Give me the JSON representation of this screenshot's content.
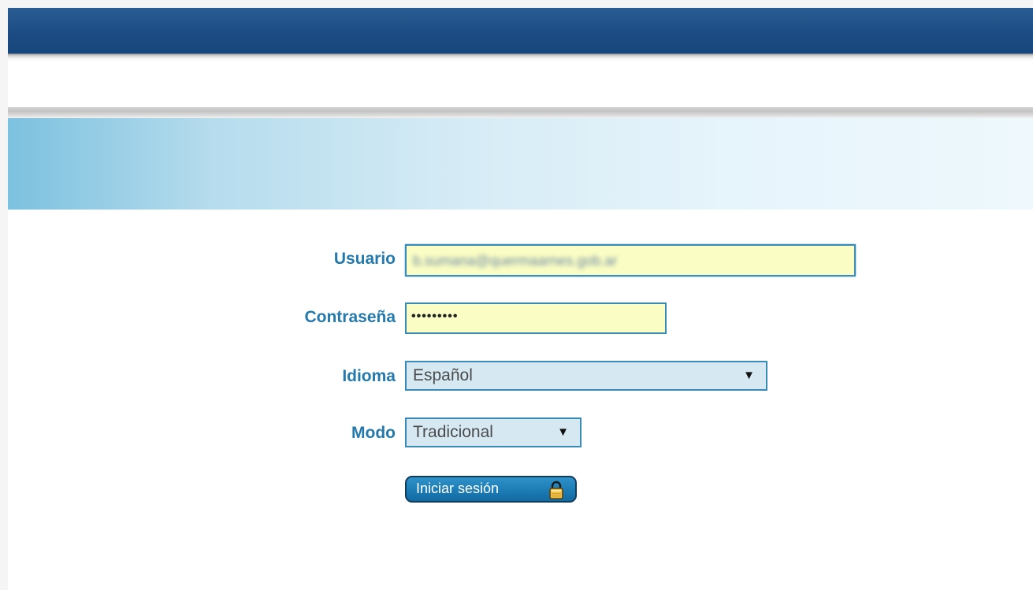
{
  "form": {
    "user": {
      "label": "Usuario",
      "value": "b.sumana@quermaarnes.gob.ar"
    },
    "password": {
      "label": "Contraseña",
      "value": "•••••••••"
    },
    "language": {
      "label": "Idioma",
      "selected": "Español"
    },
    "mode": {
      "label": "Modo",
      "selected": "Tradicional"
    },
    "submit_label": "Iniciar sesión"
  },
  "icons": {
    "submit": "lock-icon",
    "dropdown": "chevron-down-icon"
  },
  "colors": {
    "header_bar": "#1c4c83",
    "label": "#2479ad",
    "input_fill": "#fbfec4",
    "select_fill": "#d6e8f2",
    "button": "#1e7eb6"
  }
}
